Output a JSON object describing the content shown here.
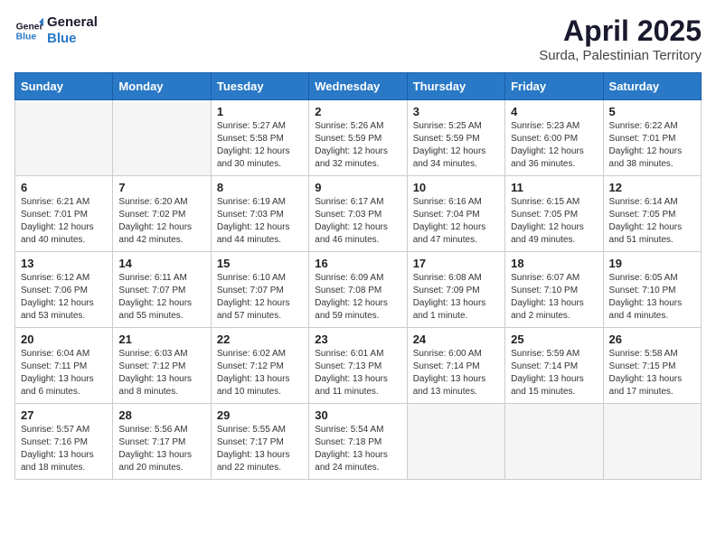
{
  "header": {
    "logo_line1": "General",
    "logo_line2": "Blue",
    "month": "April 2025",
    "location": "Surda, Palestinian Territory"
  },
  "weekdays": [
    "Sunday",
    "Monday",
    "Tuesday",
    "Wednesday",
    "Thursday",
    "Friday",
    "Saturday"
  ],
  "weeks": [
    [
      {
        "day": "",
        "info": ""
      },
      {
        "day": "",
        "info": ""
      },
      {
        "day": "1",
        "info": "Sunrise: 5:27 AM\nSunset: 5:58 PM\nDaylight: 12 hours\nand 30 minutes."
      },
      {
        "day": "2",
        "info": "Sunrise: 5:26 AM\nSunset: 5:59 PM\nDaylight: 12 hours\nand 32 minutes."
      },
      {
        "day": "3",
        "info": "Sunrise: 5:25 AM\nSunset: 5:59 PM\nDaylight: 12 hours\nand 34 minutes."
      },
      {
        "day": "4",
        "info": "Sunrise: 5:23 AM\nSunset: 6:00 PM\nDaylight: 12 hours\nand 36 minutes."
      },
      {
        "day": "5",
        "info": "Sunrise: 6:22 AM\nSunset: 7:01 PM\nDaylight: 12 hours\nand 38 minutes."
      }
    ],
    [
      {
        "day": "6",
        "info": "Sunrise: 6:21 AM\nSunset: 7:01 PM\nDaylight: 12 hours\nand 40 minutes."
      },
      {
        "day": "7",
        "info": "Sunrise: 6:20 AM\nSunset: 7:02 PM\nDaylight: 12 hours\nand 42 minutes."
      },
      {
        "day": "8",
        "info": "Sunrise: 6:19 AM\nSunset: 7:03 PM\nDaylight: 12 hours\nand 44 minutes."
      },
      {
        "day": "9",
        "info": "Sunrise: 6:17 AM\nSunset: 7:03 PM\nDaylight: 12 hours\nand 46 minutes."
      },
      {
        "day": "10",
        "info": "Sunrise: 6:16 AM\nSunset: 7:04 PM\nDaylight: 12 hours\nand 47 minutes."
      },
      {
        "day": "11",
        "info": "Sunrise: 6:15 AM\nSunset: 7:05 PM\nDaylight: 12 hours\nand 49 minutes."
      },
      {
        "day": "12",
        "info": "Sunrise: 6:14 AM\nSunset: 7:05 PM\nDaylight: 12 hours\nand 51 minutes."
      }
    ],
    [
      {
        "day": "13",
        "info": "Sunrise: 6:12 AM\nSunset: 7:06 PM\nDaylight: 12 hours\nand 53 minutes."
      },
      {
        "day": "14",
        "info": "Sunrise: 6:11 AM\nSunset: 7:07 PM\nDaylight: 12 hours\nand 55 minutes."
      },
      {
        "day": "15",
        "info": "Sunrise: 6:10 AM\nSunset: 7:07 PM\nDaylight: 12 hours\nand 57 minutes."
      },
      {
        "day": "16",
        "info": "Sunrise: 6:09 AM\nSunset: 7:08 PM\nDaylight: 12 hours\nand 59 minutes."
      },
      {
        "day": "17",
        "info": "Sunrise: 6:08 AM\nSunset: 7:09 PM\nDaylight: 13 hours\nand 1 minute."
      },
      {
        "day": "18",
        "info": "Sunrise: 6:07 AM\nSunset: 7:10 PM\nDaylight: 13 hours\nand 2 minutes."
      },
      {
        "day": "19",
        "info": "Sunrise: 6:05 AM\nSunset: 7:10 PM\nDaylight: 13 hours\nand 4 minutes."
      }
    ],
    [
      {
        "day": "20",
        "info": "Sunrise: 6:04 AM\nSunset: 7:11 PM\nDaylight: 13 hours\nand 6 minutes."
      },
      {
        "day": "21",
        "info": "Sunrise: 6:03 AM\nSunset: 7:12 PM\nDaylight: 13 hours\nand 8 minutes."
      },
      {
        "day": "22",
        "info": "Sunrise: 6:02 AM\nSunset: 7:12 PM\nDaylight: 13 hours\nand 10 minutes."
      },
      {
        "day": "23",
        "info": "Sunrise: 6:01 AM\nSunset: 7:13 PM\nDaylight: 13 hours\nand 11 minutes."
      },
      {
        "day": "24",
        "info": "Sunrise: 6:00 AM\nSunset: 7:14 PM\nDaylight: 13 hours\nand 13 minutes."
      },
      {
        "day": "25",
        "info": "Sunrise: 5:59 AM\nSunset: 7:14 PM\nDaylight: 13 hours\nand 15 minutes."
      },
      {
        "day": "26",
        "info": "Sunrise: 5:58 AM\nSunset: 7:15 PM\nDaylight: 13 hours\nand 17 minutes."
      }
    ],
    [
      {
        "day": "27",
        "info": "Sunrise: 5:57 AM\nSunset: 7:16 PM\nDaylight: 13 hours\nand 18 minutes."
      },
      {
        "day": "28",
        "info": "Sunrise: 5:56 AM\nSunset: 7:17 PM\nDaylight: 13 hours\nand 20 minutes."
      },
      {
        "day": "29",
        "info": "Sunrise: 5:55 AM\nSunset: 7:17 PM\nDaylight: 13 hours\nand 22 minutes."
      },
      {
        "day": "30",
        "info": "Sunrise: 5:54 AM\nSunset: 7:18 PM\nDaylight: 13 hours\nand 24 minutes."
      },
      {
        "day": "",
        "info": ""
      },
      {
        "day": "",
        "info": ""
      },
      {
        "day": "",
        "info": ""
      }
    ]
  ]
}
